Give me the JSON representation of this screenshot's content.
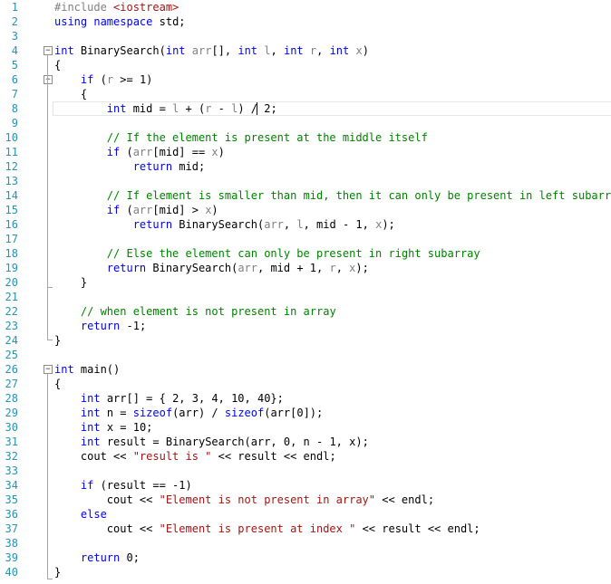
{
  "editor": {
    "language": "C++",
    "colors": {
      "keyword": "#0000ff",
      "preprocessor": "#808080",
      "string": "#a31515",
      "comment": "#008000",
      "parameter": "#808080",
      "line_number": "#2b91af",
      "text": "#000000"
    },
    "lines": [
      {
        "n": "1",
        "tokens": [
          [
            "pp",
            "#include "
          ],
          [
            "inc",
            "<iostream>"
          ]
        ]
      },
      {
        "n": "2",
        "tokens": [
          [
            "kw",
            "using"
          ],
          [
            "tx",
            " "
          ],
          [
            "kw",
            "namespace"
          ],
          [
            "tx",
            " std;"
          ]
        ]
      },
      {
        "n": "3",
        "tokens": []
      },
      {
        "n": "4",
        "tokens": [
          [
            "kw",
            "int"
          ],
          [
            "tx",
            " BinarySearch("
          ],
          [
            "kw",
            "int"
          ],
          [
            "tx",
            " "
          ],
          [
            "par",
            "arr"
          ],
          [
            "tx",
            "[], "
          ],
          [
            "kw",
            "int"
          ],
          [
            "tx",
            " "
          ],
          [
            "par",
            "l"
          ],
          [
            "tx",
            ", "
          ],
          [
            "kw",
            "int"
          ],
          [
            "tx",
            " "
          ],
          [
            "par",
            "r"
          ],
          [
            "tx",
            ", "
          ],
          [
            "kw",
            "int"
          ],
          [
            "tx",
            " "
          ],
          [
            "par",
            "x"
          ],
          [
            "tx",
            ")"
          ]
        ]
      },
      {
        "n": "5",
        "tokens": [
          [
            "tx",
            "{"
          ]
        ]
      },
      {
        "n": "6",
        "tokens": [
          [
            "tx",
            "    "
          ],
          [
            "kw",
            "if"
          ],
          [
            "tx",
            " ("
          ],
          [
            "par",
            "r"
          ],
          [
            "tx",
            " >= 1)"
          ]
        ]
      },
      {
        "n": "7",
        "tokens": [
          [
            "tx",
            "    {"
          ]
        ]
      },
      {
        "n": "8",
        "tokens": [
          [
            "tx",
            "        "
          ],
          [
            "kw",
            "int"
          ],
          [
            "tx",
            " mid = "
          ],
          [
            "par",
            "l"
          ],
          [
            "tx",
            " + ("
          ],
          [
            "par",
            "r"
          ],
          [
            "tx",
            " - "
          ],
          [
            "par",
            "l"
          ],
          [
            "tx",
            ") / 2;"
          ]
        ]
      },
      {
        "n": "9",
        "tokens": []
      },
      {
        "n": "10",
        "tokens": [
          [
            "tx",
            "        "
          ],
          [
            "cm",
            "// If the element is present at the middle itself"
          ]
        ]
      },
      {
        "n": "11",
        "tokens": [
          [
            "tx",
            "        "
          ],
          [
            "kw",
            "if"
          ],
          [
            "tx",
            " ("
          ],
          [
            "par",
            "arr"
          ],
          [
            "tx",
            "[mid] == "
          ],
          [
            "par",
            "x"
          ],
          [
            "tx",
            ")"
          ]
        ]
      },
      {
        "n": "12",
        "tokens": [
          [
            "tx",
            "            "
          ],
          [
            "kw",
            "return"
          ],
          [
            "tx",
            " mid;"
          ]
        ]
      },
      {
        "n": "13",
        "tokens": []
      },
      {
        "n": "14",
        "tokens": [
          [
            "tx",
            "        "
          ],
          [
            "cm",
            "// If element is smaller than mid, then it can only be present in left subarray"
          ]
        ]
      },
      {
        "n": "15",
        "tokens": [
          [
            "tx",
            "        "
          ],
          [
            "kw",
            "if"
          ],
          [
            "tx",
            " ("
          ],
          [
            "par",
            "arr"
          ],
          [
            "tx",
            "[mid] > "
          ],
          [
            "par",
            "x"
          ],
          [
            "tx",
            ")"
          ]
        ]
      },
      {
        "n": "16",
        "tokens": [
          [
            "tx",
            "            "
          ],
          [
            "kw",
            "return"
          ],
          [
            "tx",
            " BinarySearch("
          ],
          [
            "par",
            "arr"
          ],
          [
            "tx",
            ", "
          ],
          [
            "par",
            "l"
          ],
          [
            "tx",
            ", mid - 1, "
          ],
          [
            "par",
            "x"
          ],
          [
            "tx",
            ");"
          ]
        ]
      },
      {
        "n": "17",
        "tokens": []
      },
      {
        "n": "18",
        "tokens": [
          [
            "tx",
            "        "
          ],
          [
            "cm",
            "// Else the element can only be present in right subarray"
          ]
        ]
      },
      {
        "n": "19",
        "tokens": [
          [
            "tx",
            "        "
          ],
          [
            "kw",
            "return"
          ],
          [
            "tx",
            " BinarySearch("
          ],
          [
            "par",
            "arr"
          ],
          [
            "tx",
            ", mid + 1, "
          ],
          [
            "par",
            "r"
          ],
          [
            "tx",
            ", "
          ],
          [
            "par",
            "x"
          ],
          [
            "tx",
            ");"
          ]
        ]
      },
      {
        "n": "20",
        "tokens": [
          [
            "tx",
            "    }"
          ]
        ]
      },
      {
        "n": "21",
        "tokens": []
      },
      {
        "n": "22",
        "tokens": [
          [
            "tx",
            "    "
          ],
          [
            "cm",
            "// when element is not present in array"
          ]
        ]
      },
      {
        "n": "23",
        "tokens": [
          [
            "tx",
            "    "
          ],
          [
            "kw",
            "return"
          ],
          [
            "tx",
            " -1;"
          ]
        ]
      },
      {
        "n": "24",
        "tokens": [
          [
            "tx",
            "}"
          ]
        ]
      },
      {
        "n": "25",
        "tokens": []
      },
      {
        "n": "26",
        "tokens": [
          [
            "kw",
            "int"
          ],
          [
            "tx",
            " main()"
          ]
        ]
      },
      {
        "n": "27",
        "tokens": [
          [
            "tx",
            "{"
          ]
        ]
      },
      {
        "n": "28",
        "tokens": [
          [
            "tx",
            "    "
          ],
          [
            "kw",
            "int"
          ],
          [
            "tx",
            " arr[] = { 2, 3, 4, 10, 40};"
          ]
        ]
      },
      {
        "n": "29",
        "tokens": [
          [
            "tx",
            "    "
          ],
          [
            "kw",
            "int"
          ],
          [
            "tx",
            " n = "
          ],
          [
            "kw",
            "sizeof"
          ],
          [
            "tx",
            "(arr) / "
          ],
          [
            "kw",
            "sizeof"
          ],
          [
            "tx",
            "(arr[0]);"
          ]
        ]
      },
      {
        "n": "30",
        "tokens": [
          [
            "tx",
            "    "
          ],
          [
            "kw",
            "int"
          ],
          [
            "tx",
            " x = 10;"
          ]
        ]
      },
      {
        "n": "31",
        "tokens": [
          [
            "tx",
            "    "
          ],
          [
            "kw",
            "int"
          ],
          [
            "tx",
            " result = BinarySearch(arr, 0, n - 1, x);"
          ]
        ]
      },
      {
        "n": "32",
        "tokens": [
          [
            "tx",
            "    cout << "
          ],
          [
            "str",
            "\"result is \""
          ],
          [
            "tx",
            " << result << endl;"
          ]
        ]
      },
      {
        "n": "33",
        "tokens": []
      },
      {
        "n": "34",
        "tokens": [
          [
            "tx",
            "    "
          ],
          [
            "kw",
            "if"
          ],
          [
            "tx",
            " (result == -1)"
          ]
        ]
      },
      {
        "n": "35",
        "tokens": [
          [
            "tx",
            "        cout << "
          ],
          [
            "str",
            "\"Element is not present in array\""
          ],
          [
            "tx",
            " << endl;"
          ]
        ]
      },
      {
        "n": "36",
        "tokens": [
          [
            "tx",
            "    "
          ],
          [
            "kw",
            "else"
          ]
        ]
      },
      {
        "n": "37",
        "tokens": [
          [
            "tx",
            "        cout << "
          ],
          [
            "str",
            "\"Element is present at index \""
          ],
          [
            "tx",
            " << result << endl;"
          ]
        ]
      },
      {
        "n": "38",
        "tokens": []
      },
      {
        "n": "39",
        "tokens": [
          [
            "tx",
            "    "
          ],
          [
            "kw",
            "return"
          ],
          [
            "tx",
            " 0;"
          ]
        ]
      },
      {
        "n": "40",
        "tokens": [
          [
            "tx",
            "}"
          ]
        ]
      }
    ]
  }
}
